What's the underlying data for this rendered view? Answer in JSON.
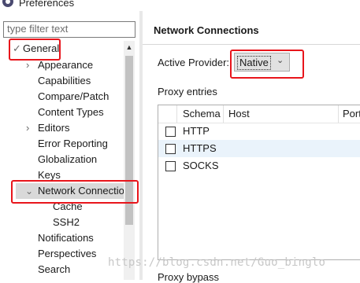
{
  "window": {
    "title": "Preferences",
    "icon": "eclipse-icon"
  },
  "filter": {
    "placeholder": "type filter text"
  },
  "tree": {
    "items": [
      {
        "label": "General",
        "arrow": "✓",
        "expanded": true
      },
      {
        "label": "Appearance",
        "arrow": "›"
      },
      {
        "label": "Capabilities"
      },
      {
        "label": "Compare/Patch"
      },
      {
        "label": "Content Types"
      },
      {
        "label": "Editors",
        "arrow": "›"
      },
      {
        "label": "Error Reporting"
      },
      {
        "label": "Globalization"
      },
      {
        "label": "Keys"
      },
      {
        "label": "Network Connectio",
        "arrow": "⌄",
        "selected": true
      },
      {
        "label": "Cache"
      },
      {
        "label": "SSH2"
      },
      {
        "label": "Notifications"
      },
      {
        "label": "Perspectives"
      },
      {
        "label": "Search"
      }
    ]
  },
  "page": {
    "title": "Network Connections",
    "active_provider_label": "Active Provider:",
    "active_provider_value": "Native",
    "proxy_entries_label": "Proxy entries",
    "table": {
      "columns": [
        "Schema",
        "Host",
        "Port"
      ],
      "rows": [
        "HTTP",
        "HTTPS",
        "SOCKS"
      ]
    },
    "proxy_bypass_label": "Proxy bypass"
  },
  "watermark": "https://blog.csdn.net/Guo_binglo",
  "colors": {
    "annotation_red": "#e8151b",
    "selection": "#d9d9d9",
    "row_highlight": "#eaf3fb"
  }
}
